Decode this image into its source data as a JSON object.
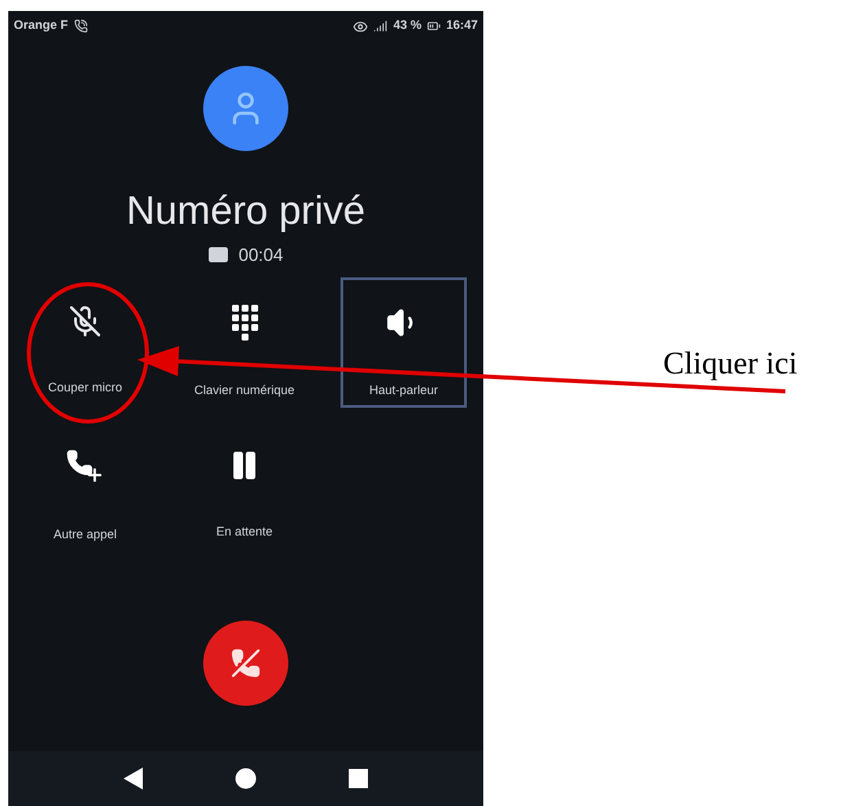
{
  "status_bar": {
    "carrier": "Orange F",
    "battery": "43 %",
    "time": "16:47"
  },
  "caller": {
    "name": "Numéro privé",
    "duration": "00:04"
  },
  "actions": [
    {
      "label": "Couper micro",
      "selected": false
    },
    {
      "label": "Clavier numérique",
      "selected": false
    },
    {
      "label": "Haut-parleur",
      "selected": true
    },
    {
      "label": "Autre appel",
      "selected": false
    },
    {
      "label": "En attente",
      "selected": false
    }
  ],
  "annotation": {
    "text": "Cliquer ici"
  }
}
